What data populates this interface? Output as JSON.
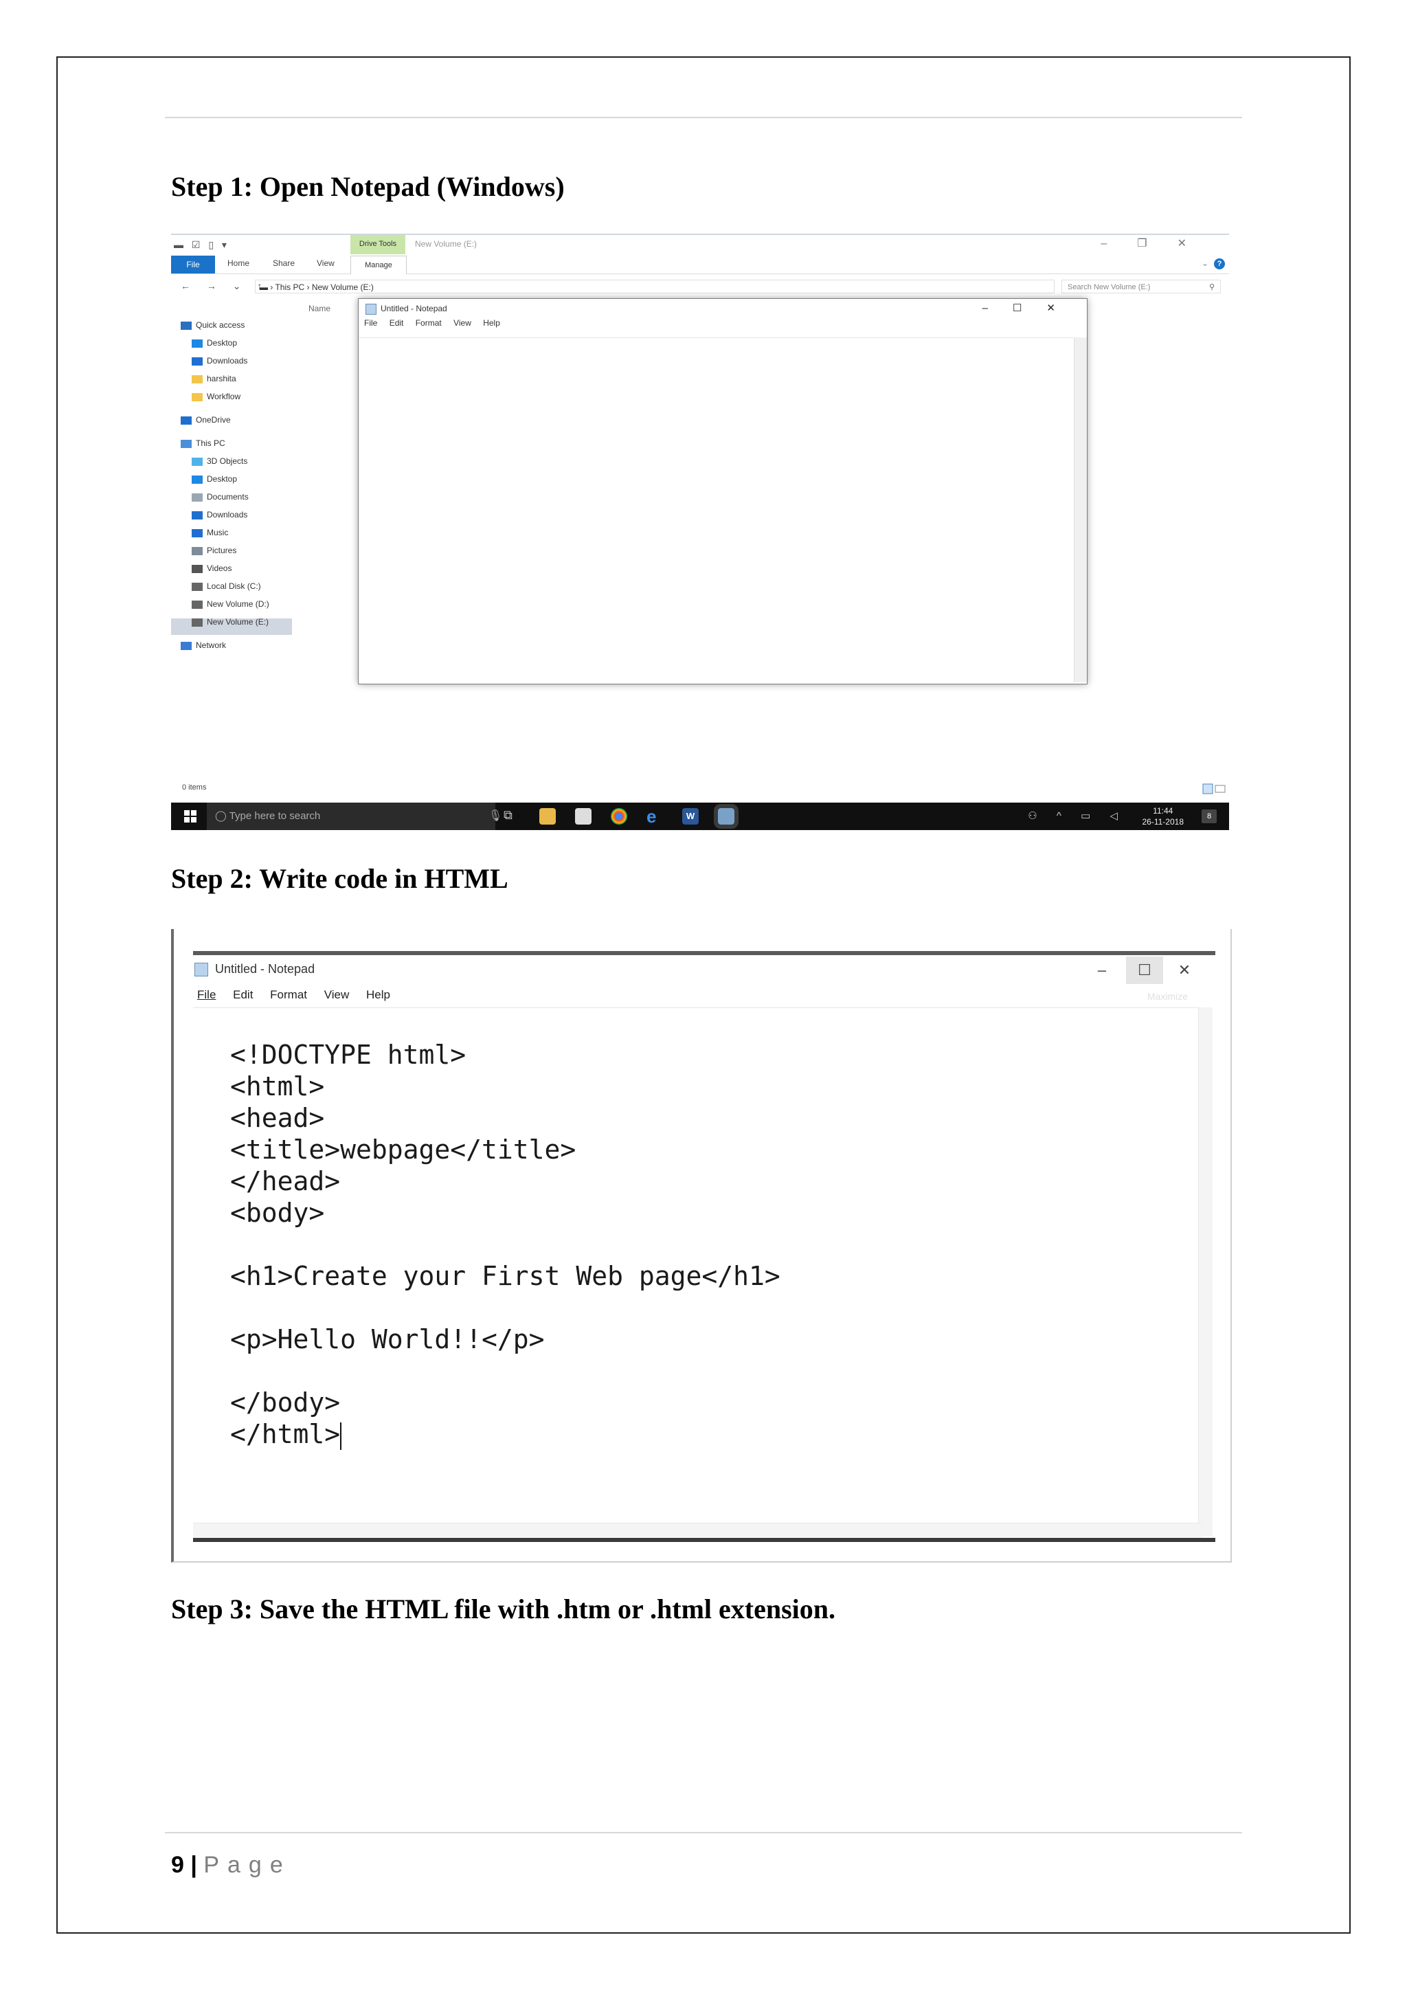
{
  "step1": {
    "heading": "Step 1: Open Notepad (Windows)"
  },
  "explorer": {
    "ribbon_context_tab": "Drive Tools",
    "window_title": "New Volume (E:)",
    "tabs": [
      "File",
      "Home",
      "Share",
      "View",
      "Manage"
    ],
    "path_root": "This PC",
    "path_current": "New Volume (E:)",
    "search_placeholder": "Search New Volume (E:)",
    "column_header": "Name",
    "nav_items": [
      {
        "label": "Quick access",
        "icon": "star-icon"
      },
      {
        "label": "Desktop",
        "icon": "desktop-icon"
      },
      {
        "label": "Downloads",
        "icon": "download-icon"
      },
      {
        "label": "harshita",
        "icon": "folder-icon"
      },
      {
        "label": "Workflow",
        "icon": "folder-icon"
      },
      {
        "label": "OneDrive",
        "icon": "cloud-icon"
      },
      {
        "label": "This PC",
        "icon": "computer-icon"
      },
      {
        "label": "3D Objects",
        "icon": "cube-icon"
      },
      {
        "label": "Desktop",
        "icon": "desktop-icon"
      },
      {
        "label": "Documents",
        "icon": "document-icon"
      },
      {
        "label": "Downloads",
        "icon": "download-icon"
      },
      {
        "label": "Music",
        "icon": "music-icon"
      },
      {
        "label": "Pictures",
        "icon": "picture-icon"
      },
      {
        "label": "Videos",
        "icon": "video-icon"
      },
      {
        "label": "Local Disk (C:)",
        "icon": "drive-icon"
      },
      {
        "label": "New Volume (D:)",
        "icon": "drive-icon"
      },
      {
        "label": "New Volume (E:)",
        "icon": "drive-icon"
      },
      {
        "label": "Network",
        "icon": "network-icon"
      }
    ],
    "status_text": "0 items"
  },
  "notepad_small": {
    "title": "Untitled - Notepad",
    "menu": [
      "File",
      "Edit",
      "Format",
      "View",
      "Help"
    ]
  },
  "taskbar": {
    "search_placeholder": "Type here to search",
    "time": "11:44",
    "date": "26-11-2018",
    "notification_count": "8"
  },
  "step2": {
    "heading": "Step 2: Write code in HTML"
  },
  "notepad_large": {
    "title": "Untitled - Notepad",
    "menu": [
      "File",
      "Edit",
      "Format",
      "View",
      "Help"
    ],
    "tooltip": "Maximize",
    "code_lines": [
      "<!DOCTYPE html>",
      "<html>",
      "<head>",
      "<title>webpage</title>",
      "</head>",
      "<body>",
      "",
      "<h1>Create your First Web page</h1>",
      "",
      "<p>Hello World!!</p>",
      "",
      "</body>",
      "</html>"
    ]
  },
  "step3": {
    "heading": "Step 3: Save the HTML file with .htm or .html extension."
  },
  "footer": {
    "page_number": "9",
    "separator": "|",
    "page_word": "Page"
  },
  "colors": {
    "ribbon_blue": "#1a73c8",
    "drive_tools_green": "#c8e6a8",
    "taskbar": "#101010"
  }
}
